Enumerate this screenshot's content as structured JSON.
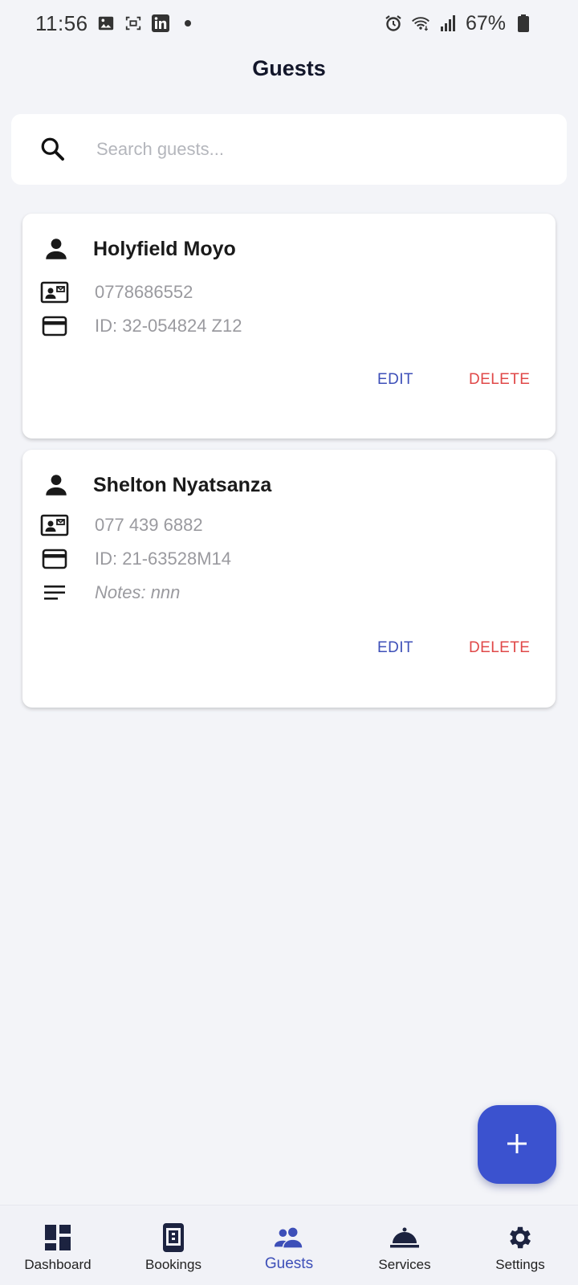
{
  "status_bar": {
    "time": "11:56",
    "battery": "67%",
    "left_icons": [
      "image-icon",
      "screen-capture-icon",
      "linkedin-icon",
      "dot-icon"
    ],
    "right_icons": [
      "alarm-icon",
      "wifi-icon",
      "signal-icon",
      "battery-icon"
    ]
  },
  "header": {
    "title": "Guests"
  },
  "search": {
    "placeholder": "Search guests...",
    "value": ""
  },
  "guests": [
    {
      "name": "Holyfield Moyo",
      "phone": "0778686552",
      "id_number": "ID: 32-054824 Z12",
      "edit_label": "EDIT",
      "delete_label": "DELETE"
    },
    {
      "name": "Shelton Nyatsanza",
      "phone": "077 439 6882",
      "id_number": "ID: 21-63528M14",
      "notes": "Notes: nnn",
      "edit_label": "EDIT",
      "delete_label": "DELETE"
    }
  ],
  "fab": {
    "icon": "plus-icon"
  },
  "bottom_nav": {
    "active": "Guests",
    "items": [
      {
        "label": "Dashboard",
        "icon": "dashboard-icon"
      },
      {
        "label": "Bookings",
        "icon": "bookings-icon"
      },
      {
        "label": "Guests",
        "icon": "guests-icon"
      },
      {
        "label": "Services",
        "icon": "room-service-icon"
      },
      {
        "label": "Settings",
        "icon": "gear-icon"
      }
    ]
  },
  "colors": {
    "accent": "#3b52cf",
    "edit": "#3d4fb8",
    "delete": "#e04848",
    "background": "#f3f4f8"
  }
}
